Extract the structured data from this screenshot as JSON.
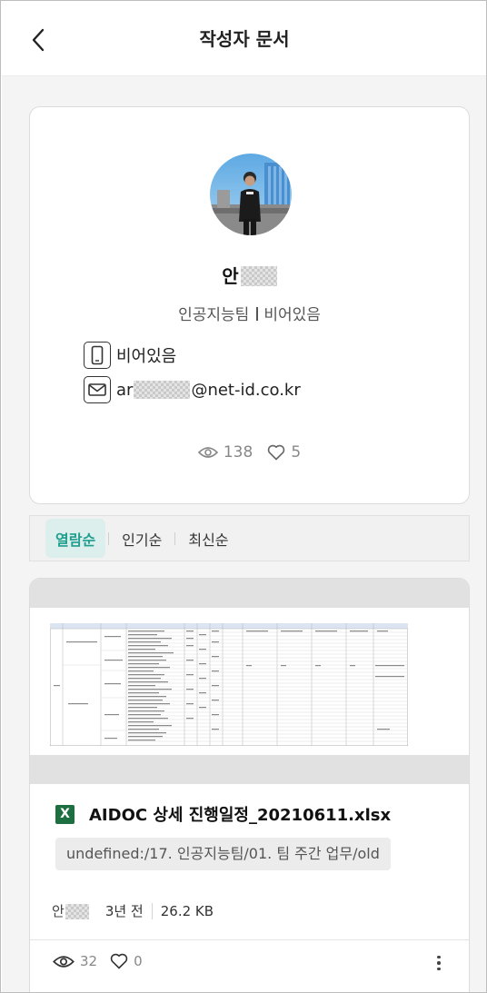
{
  "header": {
    "title": "작성자 문서",
    "back_icon": "chevron-left-icon"
  },
  "profile": {
    "name": "안",
    "department": "인공지능팀",
    "position": "비어있음",
    "phone": "비어있음",
    "email_prefix": "ar",
    "email_domain": "@net-id.co.kr",
    "views": "138",
    "likes": "5"
  },
  "sort": {
    "tabs": [
      {
        "label": "열람순",
        "active": true
      },
      {
        "label": "인기순",
        "active": false
      },
      {
        "label": "최신순",
        "active": false
      }
    ]
  },
  "document": {
    "file_type_icon": "X",
    "file_name": "AIDOC 상세 진행일정_20210611.xlsx",
    "path": "undefined:/17. 인공지능팀/01. 팀 주간 업무/old",
    "author": "안",
    "time": "3년 전",
    "size": "26.2 KB",
    "views": "32",
    "likes": "0"
  },
  "colors": {
    "accent": "#1f9e8e",
    "accent_bg": "#dcefec",
    "excel": "#1d6f42"
  }
}
